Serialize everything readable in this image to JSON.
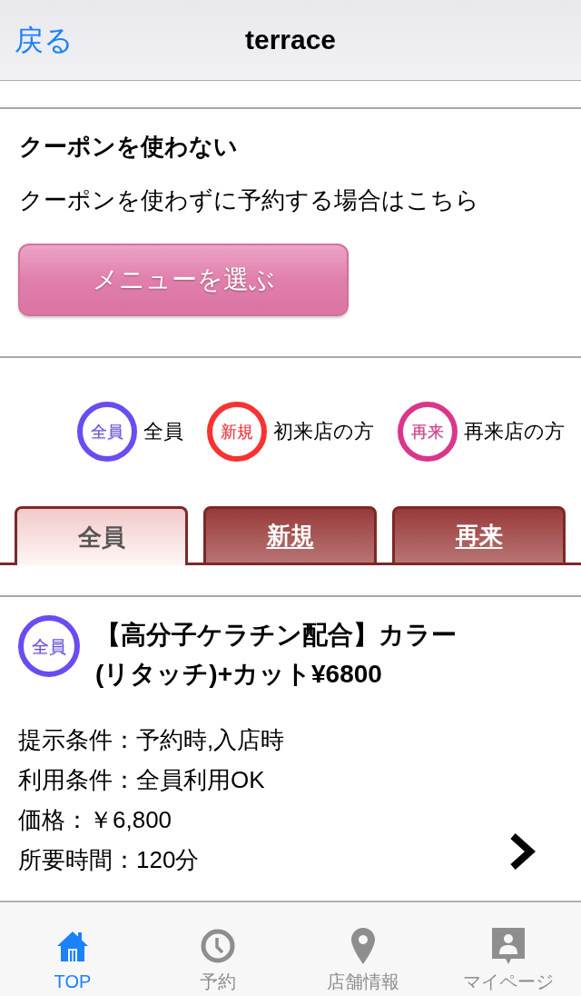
{
  "nav_bar": {
    "back": "戻る",
    "title": "terrace"
  },
  "no_coupon": {
    "heading": "クーポンを使わない",
    "text": "クーポンを使わずに予約する場合はこちら",
    "button": "メニューを選ぶ"
  },
  "legend": [
    {
      "badge": "全員",
      "label": "全員",
      "color": "#6a4cf0"
    },
    {
      "badge": "新規",
      "label": "初来店の方",
      "color": "#f83232"
    },
    {
      "badge": "再来",
      "label": "再来店の方",
      "color": "#d9378c"
    }
  ],
  "tabs": [
    {
      "label": "全員",
      "selected": true
    },
    {
      "label": "新規",
      "selected": false
    },
    {
      "label": "再来",
      "selected": false
    }
  ],
  "coupons": [
    {
      "badge": "全員",
      "color": "#6a4cf0",
      "title": "【高分子ケラチン配合】カラー(リタッチ)+カット¥6800",
      "details": [
        "提示条件：予約時,入店時",
        "利用条件：全員利用OK",
        "価格：￥6,800",
        "所要時間：120分"
      ]
    }
  ],
  "tab_bar": [
    {
      "kind": "home",
      "label": "TOP",
      "selected": true
    },
    {
      "kind": "clock",
      "label": "予約",
      "selected": false
    },
    {
      "kind": "pin",
      "label": "店舗情報",
      "selected": false
    },
    {
      "kind": "person",
      "label": "マイページ",
      "selected": false
    }
  ]
}
